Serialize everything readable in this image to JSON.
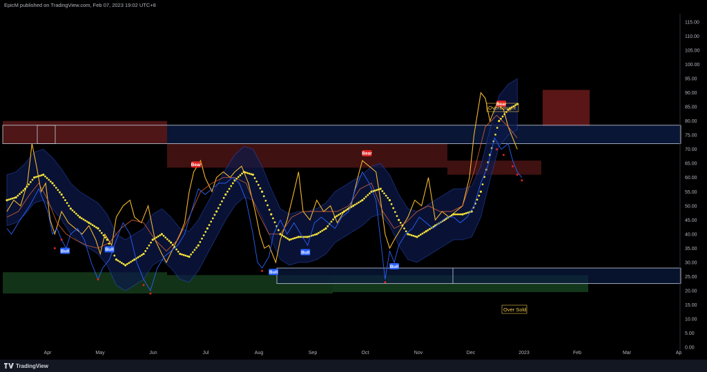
{
  "header": {
    "text": "EpicM published on TradingView.com, Feb 07, 2023 19:02 UTC+8"
  },
  "footer": {
    "brand": "TradingView"
  },
  "chart_data": {
    "type": "line",
    "y_axis_ticks": [
      "115.00",
      "110.00",
      "105.00",
      "100.00",
      "95.00",
      "90.00",
      "85.00",
      "80.00",
      "75.00",
      "70.00",
      "65.00",
      "60.00",
      "55.00",
      "50.00",
      "45.00",
      "40.00",
      "35.00",
      "30.00",
      "25.00",
      "20.00",
      "15.00",
      "10.00",
      "5.00",
      "0.00"
    ],
    "x_axis_ticks": [
      "Apr",
      "May",
      "Jun",
      "Jul",
      "Aug",
      "Sep",
      "Oct",
      "Nov",
      "Dec",
      "2023",
      "Feb",
      "Mar",
      "Ap"
    ],
    "ylim": [
      0,
      117
    ],
    "annotations": {
      "overbought": "OverBought",
      "oversold": "Over Sold",
      "signals": [
        {
          "label": "Bull",
          "x": 2.55,
          "y": 34
        },
        {
          "label": "Bull",
          "x": 4.5,
          "y": 34.5
        },
        {
          "label": "Bear",
          "x": 8.3,
          "y": 64.5
        },
        {
          "label": "Bull",
          "x": 11.7,
          "y": 26.5
        },
        {
          "label": "Bull",
          "x": 13.1,
          "y": 33.5
        },
        {
          "label": "Bear",
          "x": 15.8,
          "y": 68.5
        },
        {
          "label": "Bull",
          "x": 17.0,
          "y": 28.5
        },
        {
          "label": "Bear",
          "x": 21.7,
          "y": 86
        }
      ]
    },
    "series": [
      {
        "values": [
          [
            0,
            48
          ],
          [
            0.3,
            52
          ],
          [
            0.6,
            50
          ],
          [
            0.9,
            58
          ],
          [
            1.1,
            72
          ],
          [
            1.3,
            64
          ],
          [
            1.5,
            55
          ],
          [
            1.7,
            58
          ],
          [
            1.9,
            45
          ],
          [
            2.1,
            40
          ],
          [
            2.4,
            48
          ],
          [
            2.7,
            44
          ],
          [
            3.0,
            42
          ],
          [
            3.3,
            40
          ],
          [
            3.6,
            43
          ],
          [
            3.9,
            38
          ],
          [
            4.1,
            33
          ],
          [
            4.3,
            40
          ],
          [
            4.6,
            36
          ],
          [
            4.8,
            46
          ],
          [
            5.1,
            50
          ],
          [
            5.4,
            52
          ],
          [
            5.6,
            46
          ],
          [
            5.9,
            44
          ],
          [
            6.2,
            50
          ],
          [
            6.5,
            38
          ],
          [
            6.8,
            33
          ],
          [
            7.0,
            30
          ],
          [
            7.3,
            35
          ],
          [
            7.6,
            40
          ],
          [
            7.8,
            44
          ],
          [
            8.0,
            55
          ],
          [
            8.2,
            62
          ],
          [
            8.5,
            66
          ],
          [
            8.7,
            60
          ],
          [
            9.0,
            55
          ],
          [
            9.2,
            60
          ],
          [
            9.5,
            62
          ],
          [
            9.8,
            60
          ],
          [
            10.0,
            62
          ],
          [
            10.3,
            64
          ],
          [
            10.6,
            58
          ],
          [
            10.9,
            48
          ],
          [
            11.1,
            40
          ],
          [
            11.3,
            35
          ],
          [
            11.5,
            36
          ],
          [
            11.8,
            30
          ],
          [
            12.0,
            38
          ],
          [
            12.3,
            45
          ],
          [
            12.6,
            55
          ],
          [
            12.8,
            62
          ],
          [
            13.0,
            48
          ],
          [
            13.3,
            45
          ],
          [
            13.6,
            52
          ],
          [
            13.9,
            48
          ],
          [
            14.2,
            50
          ],
          [
            14.5,
            44
          ],
          [
            14.8,
            48
          ],
          [
            15.1,
            50
          ],
          [
            15.4,
            60
          ],
          [
            15.6,
            66
          ],
          [
            15.9,
            64
          ],
          [
            16.2,
            62
          ],
          [
            16.4,
            52
          ],
          [
            16.6,
            40
          ],
          [
            16.8,
            35
          ],
          [
            17.0,
            38
          ],
          [
            17.3,
            42
          ],
          [
            17.6,
            46
          ],
          [
            17.9,
            52
          ],
          [
            18.2,
            50
          ],
          [
            18.5,
            60
          ],
          [
            18.8,
            45
          ],
          [
            19.1,
            48
          ],
          [
            19.4,
            46
          ],
          [
            19.7,
            48
          ],
          [
            20.0,
            50
          ],
          [
            20.3,
            60
          ],
          [
            20.5,
            75
          ],
          [
            20.8,
            90
          ],
          [
            21.0,
            88
          ],
          [
            21.2,
            80
          ],
          [
            21.5,
            86
          ],
          [
            21.8,
            84
          ],
          [
            22.0,
            78
          ],
          [
            22.2,
            74
          ],
          [
            22.4,
            70
          ]
        ],
        "color": "#f5b82e"
      },
      {
        "values": [
          [
            0,
            46
          ],
          [
            0.5,
            48
          ],
          [
            1.0,
            54
          ],
          [
            1.4,
            58
          ],
          [
            1.8,
            52
          ],
          [
            2.2,
            44
          ],
          [
            2.6,
            40
          ],
          [
            3.0,
            38
          ],
          [
            3.5,
            36
          ],
          [
            4.0,
            35
          ],
          [
            4.5,
            37
          ],
          [
            5.0,
            42
          ],
          [
            5.5,
            45
          ],
          [
            6.0,
            44
          ],
          [
            6.5,
            38
          ],
          [
            7.0,
            34
          ],
          [
            7.5,
            38
          ],
          [
            8.0,
            46
          ],
          [
            8.5,
            55
          ],
          [
            9.0,
            58
          ],
          [
            9.5,
            60
          ],
          [
            10.0,
            60
          ],
          [
            10.5,
            58
          ],
          [
            11.0,
            48
          ],
          [
            11.5,
            40
          ],
          [
            12.0,
            40
          ],
          [
            12.5,
            46
          ],
          [
            13.0,
            48
          ],
          [
            13.5,
            48
          ],
          [
            14.0,
            48
          ],
          [
            14.5,
            48
          ],
          [
            15.0,
            50
          ],
          [
            15.5,
            56
          ],
          [
            16.0,
            58
          ],
          [
            16.5,
            48
          ],
          [
            17.0,
            42
          ],
          [
            17.5,
            44
          ],
          [
            18.0,
            48
          ],
          [
            18.5,
            50
          ],
          [
            19.0,
            48
          ],
          [
            19.5,
            48
          ],
          [
            20.0,
            50
          ],
          [
            20.5,
            62
          ],
          [
            21.0,
            78
          ],
          [
            21.5,
            82
          ],
          [
            22.0,
            78
          ],
          [
            22.4,
            74
          ]
        ],
        "color": "#e0673a"
      },
      {
        "values": [
          [
            0,
            52
          ],
          [
            0.4,
            53
          ],
          [
            0.8,
            56
          ],
          [
            1.2,
            60
          ],
          [
            1.6,
            61
          ],
          [
            2.0,
            58
          ],
          [
            2.4,
            54
          ],
          [
            2.8,
            49
          ],
          [
            3.2,
            46
          ],
          [
            3.6,
            44
          ],
          [
            4.0,
            42
          ],
          [
            4.4,
            38
          ],
          [
            4.8,
            31
          ],
          [
            5.2,
            29
          ],
          [
            5.6,
            31
          ],
          [
            6.0,
            33
          ],
          [
            6.4,
            38
          ],
          [
            6.8,
            40
          ],
          [
            7.2,
            37
          ],
          [
            7.6,
            33
          ],
          [
            8.0,
            32
          ],
          [
            8.4,
            36
          ],
          [
            8.8,
            42
          ],
          [
            9.2,
            48
          ],
          [
            9.6,
            54
          ],
          [
            10.0,
            59
          ],
          [
            10.4,
            62
          ],
          [
            10.8,
            61
          ],
          [
            11.2,
            55
          ],
          [
            11.6,
            47
          ],
          [
            12.0,
            40
          ],
          [
            12.4,
            38
          ],
          [
            12.8,
            39
          ],
          [
            13.2,
            39
          ],
          [
            13.6,
            40
          ],
          [
            14.0,
            42
          ],
          [
            14.4,
            46
          ],
          [
            14.8,
            48
          ],
          [
            15.2,
            50
          ],
          [
            15.6,
            52
          ],
          [
            16.0,
            55
          ],
          [
            16.4,
            56
          ],
          [
            16.8,
            52
          ],
          [
            17.2,
            45
          ],
          [
            17.6,
            40
          ],
          [
            18.0,
            39
          ],
          [
            18.4,
            41
          ],
          [
            18.8,
            43
          ],
          [
            19.2,
            45
          ],
          [
            19.6,
            47
          ],
          [
            20.0,
            47
          ],
          [
            20.4,
            48
          ],
          [
            20.8,
            55
          ],
          [
            21.2,
            68
          ],
          [
            21.6,
            80
          ],
          [
            22.0,
            84
          ],
          [
            22.4,
            86
          ]
        ],
        "color": "#f5e33a"
      },
      {
        "values": [
          [
            0,
            42
          ],
          [
            0.2,
            40
          ],
          [
            0.5,
            44
          ],
          [
            1.0,
            50
          ],
          [
            1.4,
            56
          ],
          [
            1.8,
            48
          ],
          [
            2.0,
            40
          ],
          [
            2.2,
            42
          ],
          [
            2.4,
            38
          ],
          [
            2.6,
            35
          ],
          [
            2.8,
            40
          ],
          [
            3.1,
            42
          ],
          [
            3.4,
            38
          ],
          [
            3.7,
            30
          ],
          [
            4.0,
            24
          ],
          [
            4.2,
            28
          ],
          [
            4.5,
            31
          ],
          [
            4.8,
            38
          ],
          [
            5.1,
            44
          ],
          [
            5.4,
            40
          ],
          [
            5.7,
            30
          ],
          [
            6.0,
            24
          ],
          [
            6.3,
            20
          ],
          [
            6.6,
            28
          ],
          [
            6.9,
            32
          ],
          [
            7.2,
            34
          ],
          [
            7.5,
            36
          ],
          [
            7.8,
            40
          ],
          [
            8.1,
            48
          ],
          [
            8.4,
            56
          ],
          [
            8.7,
            54
          ],
          [
            9.0,
            56
          ],
          [
            9.3,
            58
          ],
          [
            9.6,
            58
          ],
          [
            9.9,
            60
          ],
          [
            10.2,
            58
          ],
          [
            10.5,
            52
          ],
          [
            10.8,
            40
          ],
          [
            11.0,
            30
          ],
          [
            11.2,
            28
          ],
          [
            11.5,
            32
          ],
          [
            11.7,
            40
          ],
          [
            12.0,
            45
          ],
          [
            12.3,
            40
          ],
          [
            12.6,
            44
          ],
          [
            12.9,
            40
          ],
          [
            13.2,
            36
          ],
          [
            13.5,
            44
          ],
          [
            13.8,
            46
          ],
          [
            14.1,
            44
          ],
          [
            14.4,
            42
          ],
          [
            14.7,
            46
          ],
          [
            15.0,
            48
          ],
          [
            15.3,
            56
          ],
          [
            15.6,
            62
          ],
          [
            15.9,
            58
          ],
          [
            16.2,
            52
          ],
          [
            16.4,
            38
          ],
          [
            16.6,
            24
          ],
          [
            16.8,
            34
          ],
          [
            17.0,
            30
          ],
          [
            17.2,
            36
          ],
          [
            17.5,
            40
          ],
          [
            17.8,
            42
          ],
          [
            18.1,
            46
          ],
          [
            18.4,
            44
          ],
          [
            18.7,
            42
          ],
          [
            19.0,
            44
          ],
          [
            19.3,
            46
          ],
          [
            19.6,
            46
          ],
          [
            19.9,
            44
          ],
          [
            20.2,
            46
          ],
          [
            20.5,
            50
          ],
          [
            20.8,
            58
          ],
          [
            21.1,
            64
          ],
          [
            21.4,
            74
          ],
          [
            21.7,
            70
          ],
          [
            22.0,
            72
          ],
          [
            22.2,
            66
          ],
          [
            22.4,
            62
          ],
          [
            22.6,
            60
          ]
        ],
        "color": "#2a62ff"
      },
      {
        "values": [
          [
            2.1,
            35
          ],
          [
            2.4,
            38
          ],
          [
            4.0,
            24
          ],
          [
            6.0,
            22
          ],
          [
            6.3,
            19
          ],
          [
            11.2,
            27
          ],
          [
            16.6,
            23
          ],
          [
            21.5,
            70
          ],
          [
            21.8,
            68
          ],
          [
            22.2,
            64
          ],
          [
            22.4,
            61
          ],
          [
            22.6,
            59
          ]
        ],
        "color": "#e02323"
      }
    ]
  }
}
